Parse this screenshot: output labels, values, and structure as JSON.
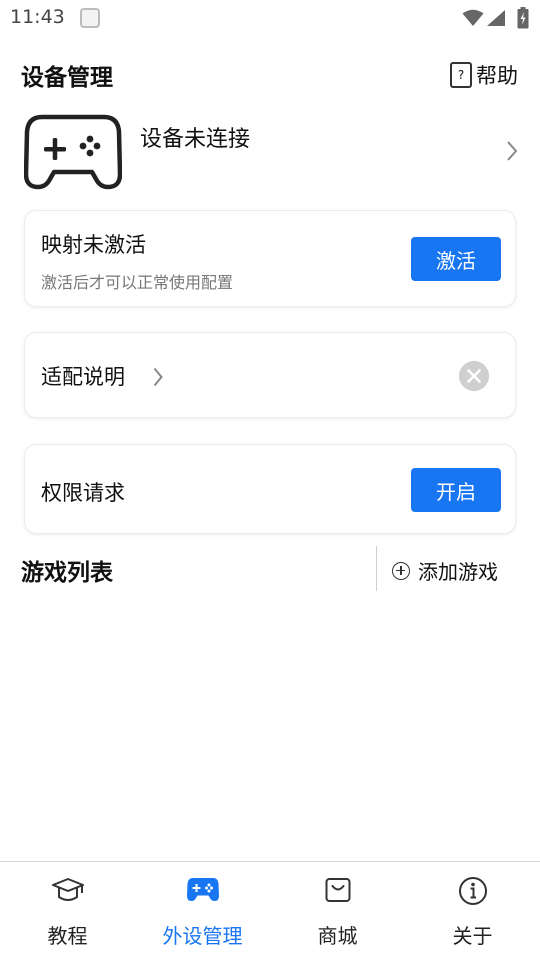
{
  "status_bar": {
    "time": "11:43"
  },
  "header": {
    "title": "设备管理",
    "help_label": "帮助"
  },
  "device": {
    "status": "设备未连接"
  },
  "mapping_card": {
    "title": "映射未激活",
    "subtitle": "激活后才可以正常使用配置",
    "button_label": "激活"
  },
  "adapt_card": {
    "title": "适配说明"
  },
  "permission_card": {
    "title": "权限请求",
    "button_label": "开启"
  },
  "games": {
    "title": "游戏列表",
    "add_label": "添加游戏"
  },
  "tabs": [
    {
      "label": "教程",
      "icon": "graduation-cap-icon",
      "active": false
    },
    {
      "label": "外设管理",
      "icon": "gamepad-icon",
      "active": true
    },
    {
      "label": "商城",
      "icon": "shopping-bag-icon",
      "active": false
    },
    {
      "label": "关于",
      "icon": "info-icon",
      "active": false
    }
  ],
  "colors": {
    "accent": "#1976f2",
    "text": "#111111",
    "muted": "#777777"
  }
}
